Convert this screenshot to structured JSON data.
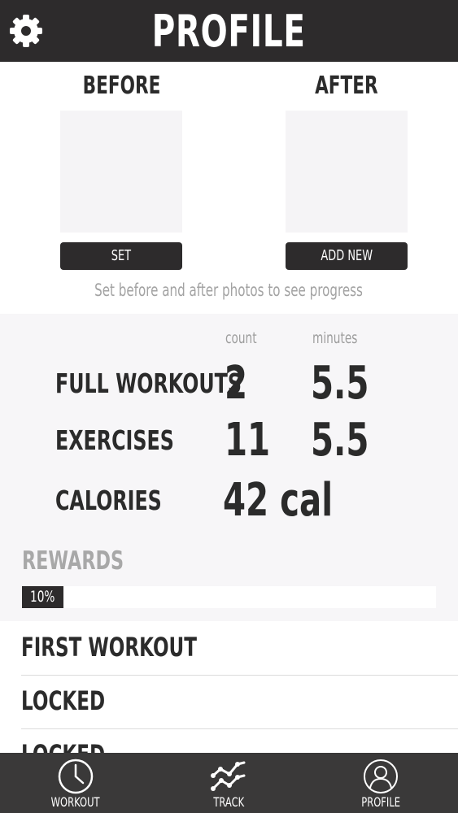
{
  "header": {
    "title": "PROFILE",
    "settings_icon": "gear-icon"
  },
  "photos": {
    "before": {
      "label": "BEFORE",
      "button": "SET"
    },
    "after": {
      "label": "AFTER",
      "button": "ADD NEW"
    },
    "hint": "Set before and after photos to see progress"
  },
  "stats": {
    "columns": {
      "count": "count",
      "minutes": "minutes"
    },
    "full_workouts": {
      "label": "FULL WORKOUTS",
      "count": "2",
      "minutes": "5.5"
    },
    "exercises": {
      "label": "EXERCISES",
      "count": "11",
      "minutes": "5.5"
    },
    "calories": {
      "label": "CALORIES",
      "value": "42 cal"
    }
  },
  "rewards": {
    "title": "REWARDS",
    "progress_label": "10%",
    "progress": 0.1,
    "items": [
      {
        "label": "FIRST WORKOUT"
      },
      {
        "label": "LOCKED"
      },
      {
        "label": "LOCKED"
      }
    ]
  },
  "nav": {
    "items": [
      {
        "label": "WORKOUT",
        "icon": "clock-icon"
      },
      {
        "label": "TRACK",
        "icon": "chart-line-icon"
      },
      {
        "label": "PROFILE",
        "icon": "user-icon"
      }
    ]
  },
  "colors": {
    "dark": "#2d2b2c",
    "nav": "#3a3939",
    "muted": "#a3a3a3",
    "panel": "#f7f6f8"
  }
}
